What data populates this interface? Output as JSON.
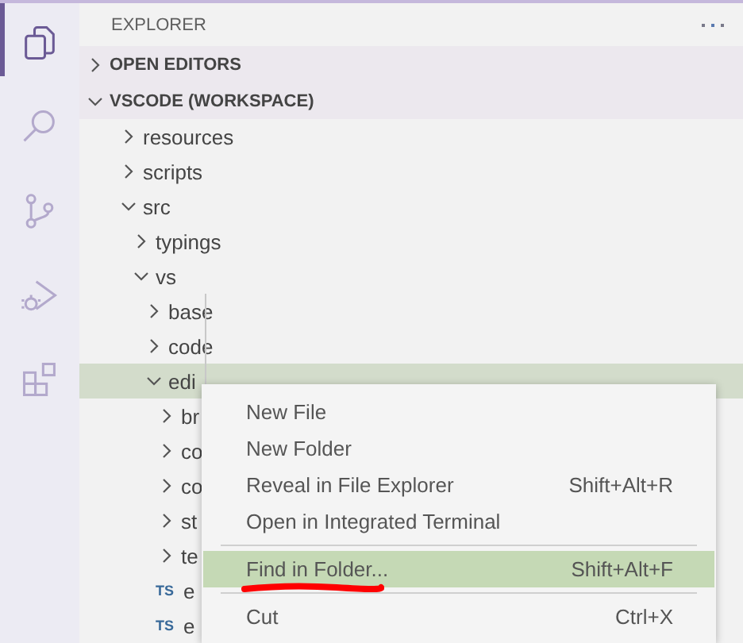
{
  "activity_bar": [
    {
      "kind": "files",
      "selected": true
    },
    {
      "kind": "search",
      "selected": false
    },
    {
      "kind": "source-control",
      "selected": false
    },
    {
      "kind": "run-debug",
      "selected": false
    },
    {
      "kind": "extensions",
      "selected": false
    }
  ],
  "sidebar": {
    "title": "EXPLORER",
    "sections": [
      {
        "label": "OPEN EDITORS",
        "expanded": false
      },
      {
        "label": "VSCODE (WORKSPACE)",
        "expanded": true
      }
    ],
    "tree": [
      {
        "label": "resources",
        "kind": "folder",
        "expanded": false,
        "selected": false
      },
      {
        "label": "scripts",
        "kind": "folder",
        "expanded": false,
        "selected": false
      },
      {
        "label": "src",
        "kind": "folder",
        "expanded": true,
        "selected": false,
        "children": [
          {
            "label": "typings",
            "kind": "folder",
            "expanded": false,
            "selected": false
          },
          {
            "label": "vs",
            "kind": "folder",
            "expanded": true,
            "selected": false,
            "children": [
              {
                "label": "base",
                "kind": "folder",
                "expanded": false,
                "selected": false
              },
              {
                "label": "code",
                "kind": "folder",
                "expanded": false,
                "selected": false
              },
              {
                "label": "edi",
                "kind": "folder",
                "expanded": true,
                "selected": true,
                "children": [
                  {
                    "label": "br",
                    "kind": "folder",
                    "expanded": false,
                    "selected": false
                  },
                  {
                    "label": "co",
                    "kind": "folder",
                    "expanded": false,
                    "selected": false
                  },
                  {
                    "label": "co",
                    "kind": "folder",
                    "expanded": false,
                    "selected": false
                  },
                  {
                    "label": "st",
                    "kind": "folder",
                    "expanded": false,
                    "selected": false
                  },
                  {
                    "label": "te",
                    "kind": "folder",
                    "expanded": false,
                    "selected": false
                  },
                  {
                    "label": "e",
                    "kind": "ts",
                    "badge": "TS",
                    "selected": false
                  },
                  {
                    "label": "e",
                    "kind": "ts",
                    "badge": "TS",
                    "selected": false
                  }
                ]
              }
            ]
          }
        ]
      }
    ]
  },
  "context_menu": {
    "items": [
      {
        "kind": "item",
        "label": "New File",
        "selected": false
      },
      {
        "kind": "item",
        "label": "New Folder",
        "selected": false
      },
      {
        "kind": "item",
        "label": "Reveal in File Explorer",
        "shortcut": "Shift+Alt+R",
        "selected": false
      },
      {
        "kind": "item",
        "label": "Open in Integrated Terminal",
        "selected": false
      },
      {
        "kind": "separator"
      },
      {
        "kind": "item",
        "label": "Find in Folder...",
        "shortcut": "Shift+Alt+F",
        "selected": true,
        "underlined": true
      },
      {
        "kind": "separator"
      },
      {
        "kind": "item",
        "label": "Cut",
        "shortcut": "Ctrl+X",
        "selected": false
      }
    ]
  }
}
